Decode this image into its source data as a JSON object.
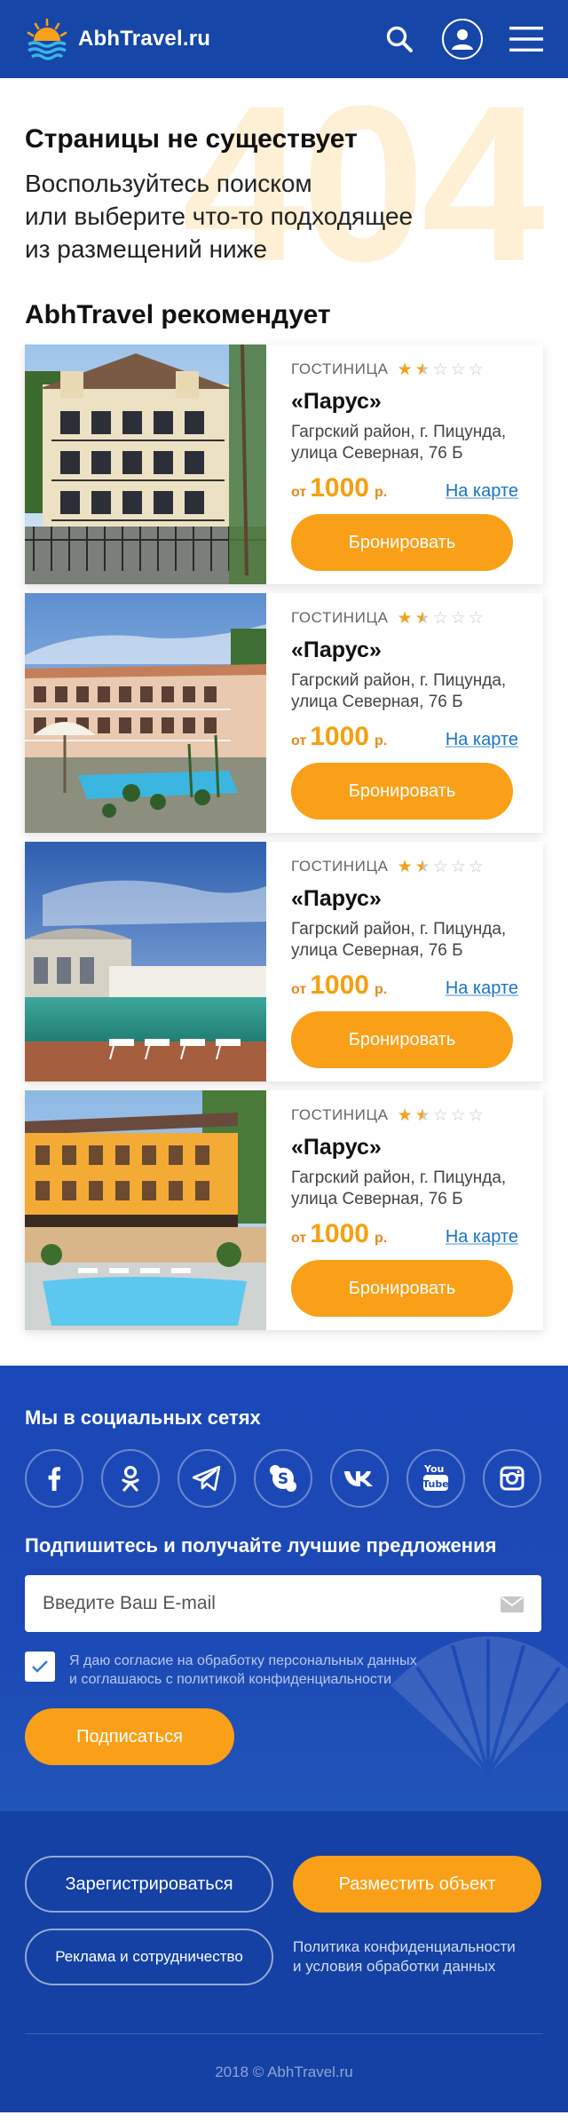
{
  "header": {
    "logo_text": "AbhTravel.ru"
  },
  "hero": {
    "bg_code": "404",
    "title": "Страницы не существует",
    "subtitle": "Воспользуйтесь поиском\nили выберите что-то подходящее\nиз размещений ниже"
  },
  "recommended": {
    "title": "AbhTravel рекомендует",
    "cards": [
      {
        "type": "ГОСТИНИЦА",
        "rating": 1.5,
        "name": "«Парус»",
        "address": "Гагрский район, г. Пицунда,\nулица Северная, 76 Б",
        "price_from": "от",
        "price": "1000",
        "currency": "р.",
        "map_label": "На карте",
        "book_label": "Бронировать"
      },
      {
        "type": "ГОСТИНИЦА",
        "rating": 1.5,
        "name": "«Парус»",
        "address": "Гагрский район, г. Пицунда,\nулица Северная, 76 Б",
        "price_from": "от",
        "price": "1000",
        "currency": "р.",
        "map_label": "На карте",
        "book_label": "Бронировать"
      },
      {
        "type": "ГОСТИНИЦА",
        "rating": 1.5,
        "name": "«Парус»",
        "address": "Гагрский район, г. Пицунда,\nулица Северная, 76 Б",
        "price_from": "от",
        "price": "1000",
        "currency": "р.",
        "map_label": "На карте",
        "book_label": "Бронировать"
      },
      {
        "type": "ГОСТИНИЦА",
        "rating": 1.5,
        "name": "«Парус»",
        "address": "Гагрский район, г. Пицунда,\nулица Северная, 76 Б",
        "price_from": "от",
        "price": "1000",
        "currency": "р.",
        "map_label": "На карте",
        "book_label": "Бронировать"
      }
    ]
  },
  "social": {
    "title": "Мы в социальных сетях",
    "networks": [
      "facebook-icon",
      "odnoklassniki-icon",
      "telegram-icon",
      "skype-icon",
      "vk-icon",
      "youtube-icon",
      "instagram-icon"
    ]
  },
  "subscribe": {
    "title": "Подпишитесь и получайте лучшие предложения",
    "email_placeholder": "Введите Ваш E-mail",
    "consent_text": "Я даю согласие на обработку персональных данных\nи соглашаюсь с политикой конфиденциальности",
    "consent_checked": true,
    "button_label": "Подписаться"
  },
  "footer": {
    "register_label": "Зарегистрироваться",
    "place_object_label": "Разместить объект",
    "ads_label": "Реклама и сотрудничество",
    "policy_label": "Политика конфиденциальности\nи условия обработки данных",
    "copyright": "2018 © AbhTravel.ru"
  },
  "colors": {
    "header_bg": "#1546a8",
    "accent": "#f9a018",
    "footer_bg": "#1441a3",
    "link": "#1b73c7"
  }
}
